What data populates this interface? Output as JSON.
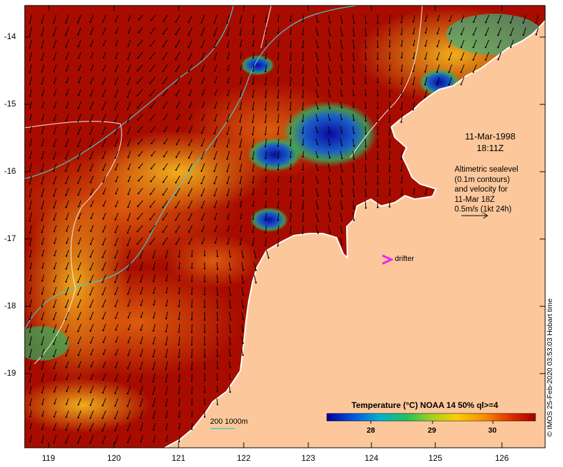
{
  "map": {
    "y_axis_labels": [
      "-14",
      "-15",
      "-16",
      "-17",
      "-18",
      "-19"
    ],
    "x_axis_labels": [
      "119",
      "120",
      "121",
      "122",
      "123",
      "124",
      "125",
      "126"
    ],
    "date_line1": "11-Mar-1998",
    "date_line2": "18:11Z",
    "altimetry_lines": [
      "Altimetric sealevel",
      "(0.1m contours)",
      "and velocity for",
      "11-Mar 18Z",
      "0.5m/s (1kt 24h)"
    ],
    "drifter_label": "drifter",
    "legend_title": "Temperature (°C) NOAA 14 50% ql>=4",
    "legend_ticks": [
      "28",
      "29",
      "30"
    ],
    "contour_legend": "200  1000m",
    "credit": "© IMOS 25-Feb-2020 03:53:03 Hobart time"
  },
  "colors": {
    "land": "#fcc89b",
    "sst_warm": "#a80c00",
    "sst_mid": "#d8500a",
    "sst_cool": "#f2b01b",
    "cold": "#0a0aa0",
    "drifter": "#ee22ee",
    "contour": "#49c9c9"
  }
}
